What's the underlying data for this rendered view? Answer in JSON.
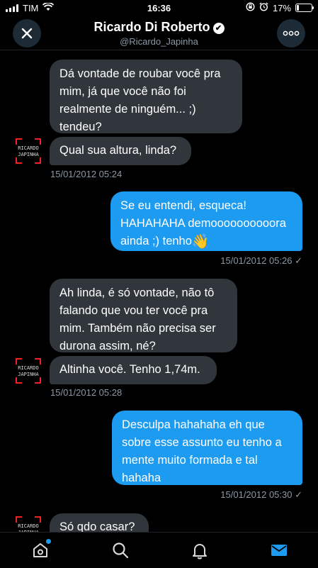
{
  "status_bar": {
    "carrier": "TIM",
    "time": "16:36",
    "battery": "17%",
    "battery_level": 0.17
  },
  "header": {
    "title": "Ricardo Di Roberto",
    "handle": "@Ricardo_Japinha"
  },
  "avatar_text": {
    "line1": "RICARDO",
    "line2": "JAPINHA"
  },
  "messages": [
    {
      "dir": "in",
      "text": "Dá vontade de roubar você pra mim, já que você não foi realmente de ninguém... ;) tendeu?"
    },
    {
      "dir": "in",
      "text": "Qual sua altura, linda?"
    },
    {
      "timestamp": "15/01/2012 05:24"
    },
    {
      "dir": "out",
      "text": "Se eu entendi, esqueca! HAHAHAHA demoooooooooora ainda ;) tenho",
      "emoji": "👋"
    },
    {
      "timestamp": "15/01/2012 05:26 ✓"
    },
    {
      "dir": "in",
      "text": "Ah linda, é só vontade, não tô falando que vou ter você pra mim. Também não precisa ser durona assim, né?"
    },
    {
      "dir": "in",
      "text": "Altinha você. Tenho 1,74m."
    },
    {
      "timestamp": "15/01/2012 05:28"
    },
    {
      "dir": "out",
      "text": "Desculpa hahahaha eh que sobre esse assunto eu tenho a mente muito formada e tal hahaha"
    },
    {
      "timestamp": "15/01/2012 05:30 ✓"
    },
    {
      "dir": "in",
      "text": "Só qdo casar?"
    }
  ],
  "nav": {
    "items": [
      "home",
      "search",
      "notifications",
      "messages"
    ],
    "active": "messages"
  },
  "colors": {
    "accent": "#1d9bf0",
    "incoming_bubble": "#30363b",
    "muted": "#8b98a5"
  }
}
